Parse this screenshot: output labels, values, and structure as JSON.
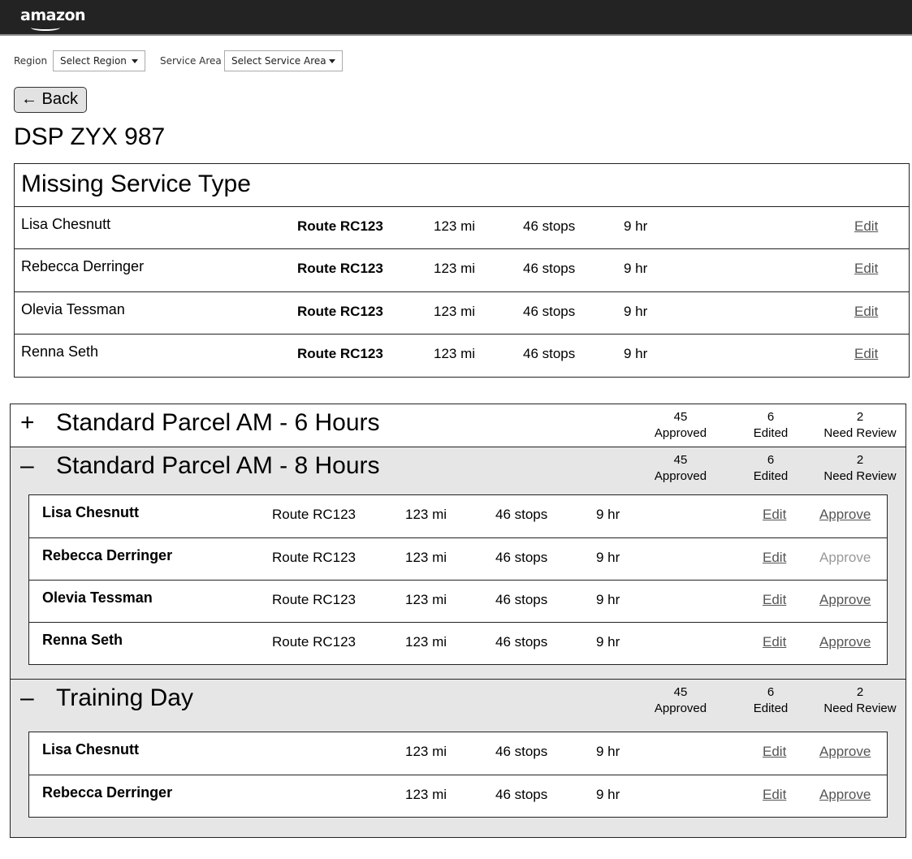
{
  "header": {
    "logo": "amazon"
  },
  "filters": {
    "region_label": "Region",
    "region_value": "Select Region",
    "service_label": "Service Area",
    "service_value": "Select Service Area"
  },
  "back_label": "← Back",
  "page_title": "DSP ZYX 987",
  "missing": {
    "title": "Missing Service Type",
    "rows": [
      {
        "name": "Lisa Chesnutt",
        "route": "Route RC123",
        "miles": "123 mi",
        "stops": "46 stops",
        "hours": "9 hr",
        "edit": "Edit"
      },
      {
        "name": "Rebecca Derringer",
        "route": "Route RC123",
        "miles": "123 mi",
        "stops": "46 stops",
        "hours": "9 hr",
        "edit": "Edit"
      },
      {
        "name": "Olevia Tessman",
        "route": "Route RC123",
        "miles": "123 mi",
        "stops": "46 stops",
        "hours": "9 hr",
        "edit": "Edit"
      },
      {
        "name": "Renna Seth",
        "route": "Route RC123",
        "miles": "123 mi",
        "stops": "46 stops",
        "hours": "9 hr",
        "edit": "Edit"
      }
    ]
  },
  "groups": [
    {
      "sign": "+",
      "title": "Standard Parcel AM - 6 Hours",
      "approved": "45",
      "approved_label": "Approved",
      "edited": "6",
      "edited_label": "Edited",
      "review": "2",
      "review_label": "Need Review"
    },
    {
      "sign": "–",
      "title": "Standard Parcel AM - 8 Hours",
      "approved": "45",
      "approved_label": "Approved",
      "edited": "6",
      "edited_label": "Edited",
      "review": "2",
      "review_label": "Need Review",
      "rows": [
        {
          "name": "Lisa Chesnutt",
          "route": "Route RC123",
          "miles": "123 mi",
          "stops": "46 stops",
          "hours": "9 hr",
          "edit": "Edit",
          "approve": "Approve"
        },
        {
          "name": "Rebecca Derringer",
          "route": "Route RC123",
          "miles": "123 mi",
          "stops": "46 stops",
          "hours": "9 hr",
          "edit": "Edit",
          "approve": "Approve"
        },
        {
          "name": "Olevia Tessman",
          "route": "Route RC123",
          "miles": "123 mi",
          "stops": "46 stops",
          "hours": "9 hr",
          "edit": "Edit",
          "approve": "Approve"
        },
        {
          "name": "Renna Seth",
          "route": "Route RC123",
          "miles": "123 mi",
          "stops": "46 stops",
          "hours": "9 hr",
          "edit": "Edit",
          "approve": "Approve"
        }
      ]
    },
    {
      "sign": "–",
      "title": "Training Day",
      "approved": "45",
      "approved_label": "Approved",
      "edited": "6",
      "edited_label": "Edited",
      "review": "2",
      "review_label": "Need Review",
      "rows": [
        {
          "name": "Lisa Chesnutt",
          "miles": "123 mi",
          "stops": "46 stops",
          "hours": "9 hr",
          "edit": "Edit",
          "approve": "Approve"
        },
        {
          "name": "Rebecca Derringer",
          "miles": "123 mi",
          "stops": "46 stops",
          "hours": "9 hr",
          "edit": "Edit",
          "approve": "Approve"
        }
      ]
    }
  ]
}
